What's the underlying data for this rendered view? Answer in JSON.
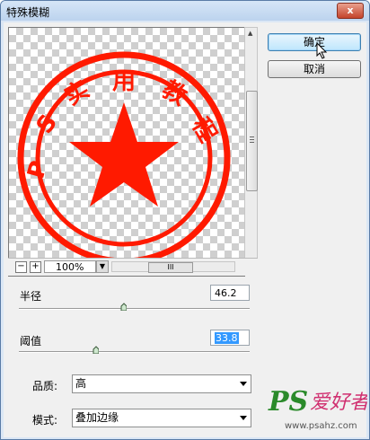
{
  "window": {
    "title": "特殊模糊",
    "close_label": "x"
  },
  "preview": {
    "stamp_top_text": [
      "P",
      "S",
      "实",
      "用",
      "教",
      "程"
    ],
    "zoom": {
      "minus_label": "−",
      "plus_label": "+",
      "value": "100%"
    },
    "colors": {
      "stamp": "#ff1a00"
    }
  },
  "buttons": {
    "ok_label": "确定",
    "cancel_label": "取消"
  },
  "params": {
    "radius": {
      "label": "半径",
      "value": "46.2"
    },
    "threshold": {
      "label": "阈值",
      "value": "33.8"
    }
  },
  "selects": {
    "quality": {
      "label": "品质:",
      "value": "高"
    },
    "mode": {
      "label": "模式:",
      "value": "叠加边缘"
    }
  },
  "watermark": {
    "brand": "PS",
    "text": "爱好者",
    "url": "www.psahz.com"
  }
}
